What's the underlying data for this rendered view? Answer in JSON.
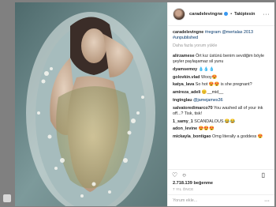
{
  "post": {
    "username": "caradelevingne",
    "separator": "•",
    "follow_label": "Takiptesin",
    "more_glyph": "···",
    "caption_user": "caradelevingne",
    "caption_text": "#regram @mertalas 2013 #unpublished",
    "load_more": "Daha fazla yorum yükle"
  },
  "comments": [
    {
      "user": "alirzamese",
      "text": "Ört kız üstünü benim sevdiğim böyle şeyler paylaşamaz sil yunu"
    },
    {
      "user": "dyamsemoy",
      "text": "💧💧💧"
    },
    {
      "user": "golovkin.vlad",
      "text": "Wooy😍"
    },
    {
      "user": "katya_lava",
      "text": "So hot 😍😍 is she pregnant?"
    },
    {
      "user": "amireza_adeli",
      "text": "😊__mid__"
    },
    {
      "user": "tngtnglau",
      "text": "@jamejames36"
    },
    {
      "user": "salvatoredimarco70",
      "text": "You washed all of your ink off...? Tisk, tisk!"
    },
    {
      "user": "1_samy_1",
      "text": "SCANDALOUS 😂😂"
    },
    {
      "user": "adon_levine",
      "text": "😍😍😍"
    },
    {
      "user": "mickayla_bontigao",
      "text": "Omg literally a goddess 😍"
    }
  ],
  "actions": {
    "like_icon": "heart-icon",
    "comment_icon": "comment-icon",
    "save_icon": "bookmark-icon"
  },
  "likes": "2.718.139 beğenme",
  "time": "7 YIL ÖNCE",
  "add_comment": {
    "placeholder": "Yorum ekle...",
    "more_glyph": "···"
  }
}
